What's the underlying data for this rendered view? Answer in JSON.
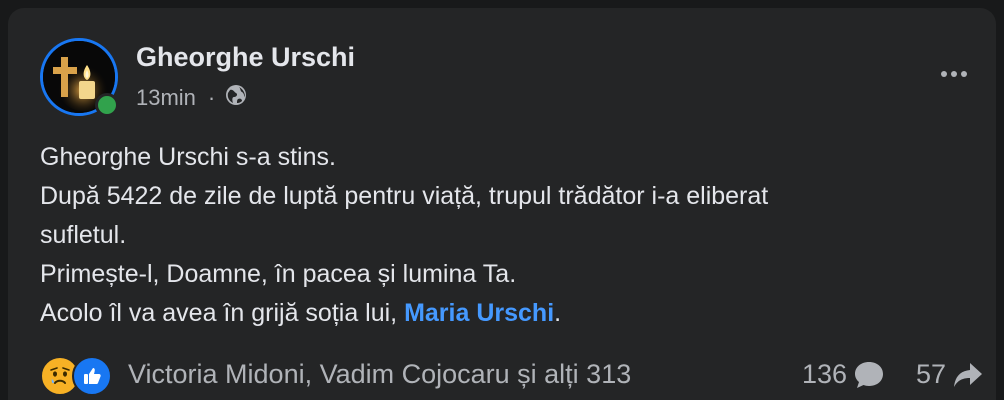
{
  "post": {
    "author": "Gheorghe Urschi",
    "time": "13min",
    "separator": "·",
    "privacy_icon": "globe-icon",
    "lines": [
      "Gheorghe Urschi s-a stins.",
      "După 5422 de zile de luptă pentru viață, trupul trădător i-a eliberat",
      "sufletul.",
      "Primește-l, Doamne, în pacea și lumina Ta."
    ],
    "last_line_prefix": "Acolo îl va avea în grijă soția lui, ",
    "mention": "Maria Urschi",
    "last_line_suffix": "."
  },
  "footer": {
    "reaction_icons": [
      "sad-icon",
      "like-icon"
    ],
    "reactors": "Victoria Midoni, Vadim Cojocaru și alți 313",
    "comment_count": "136",
    "share_count": "57"
  },
  "colors": {
    "background": "#18191a",
    "card": "#242526",
    "text_primary": "#e4e6eb",
    "text_secondary": "#b0b3b8",
    "mention": "#4599ff",
    "online": "#31a24c",
    "like": "#1877f2",
    "sad": "#f7b125"
  }
}
